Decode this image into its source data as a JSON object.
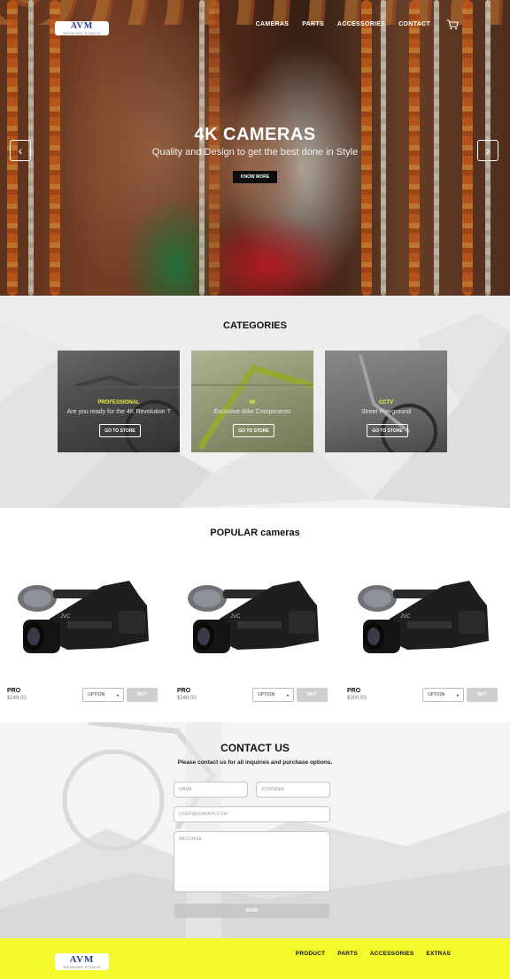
{
  "brand": {
    "logo_mark": "AVM",
    "logo_sub": "WEDDING STUDIO"
  },
  "nav": {
    "items": [
      {
        "label": "CAMERAS"
      },
      {
        "label": "PARTS"
      },
      {
        "label": "ACCESSORIES"
      },
      {
        "label": "CONTACT"
      }
    ],
    "cart_icon": "cart-icon"
  },
  "hero": {
    "title": "4K CAMERAS",
    "subtitle": "Quality and Design to get the best done in Style",
    "button": "KNOW MORE",
    "prev_icon": "chevron-left-icon",
    "next_icon": "chevron-right-icon"
  },
  "categories": {
    "title": "CATEGORIES",
    "items": [
      {
        "name": "PROFESSIONAL",
        "description": "Are you ready for the 4K Revolution ?",
        "button": "GO TO STORE",
        "tint": "#3a3a3a"
      },
      {
        "name": "4K",
        "description": "Exclusive Bike Components",
        "button": "GO TO STORE",
        "tint": "#8a9a3a"
      },
      {
        "name": "CCTV",
        "description": "Street Playground",
        "button": "GO TO STORE",
        "tint": "#3a3a3a"
      }
    ]
  },
  "popular": {
    "title": "POPULAR cameras",
    "products": [
      {
        "name": "PRO",
        "price": "$249.00",
        "option": "OPTION",
        "buy": "BUY"
      },
      {
        "name": "PRO",
        "price": "$249.00",
        "option": "OPTION",
        "buy": "BUY"
      },
      {
        "name": "PRO",
        "price": "$300.00",
        "option": "OPTION",
        "buy": "BUY"
      }
    ]
  },
  "contact": {
    "title": "CONTACT US",
    "subtitle": "Please contact us for all inquiries and purchase options.",
    "name_placeholder": "NAME",
    "surname_placeholder": "SURNAME",
    "email_placeholder": "USER@DOMAIN.COM",
    "message_placeholder": "MESSAGE",
    "send": "SEND"
  },
  "footer": {
    "items": [
      {
        "label": "PRODUCT"
      },
      {
        "label": "PARTS"
      },
      {
        "label": "ACCESSORIES"
      },
      {
        "label": "EXTRAS"
      }
    ]
  },
  "colors": {
    "accent_yellow": "#f4f92e",
    "category_label": "#e6f23a",
    "button_dark": "#0d0d0d"
  }
}
